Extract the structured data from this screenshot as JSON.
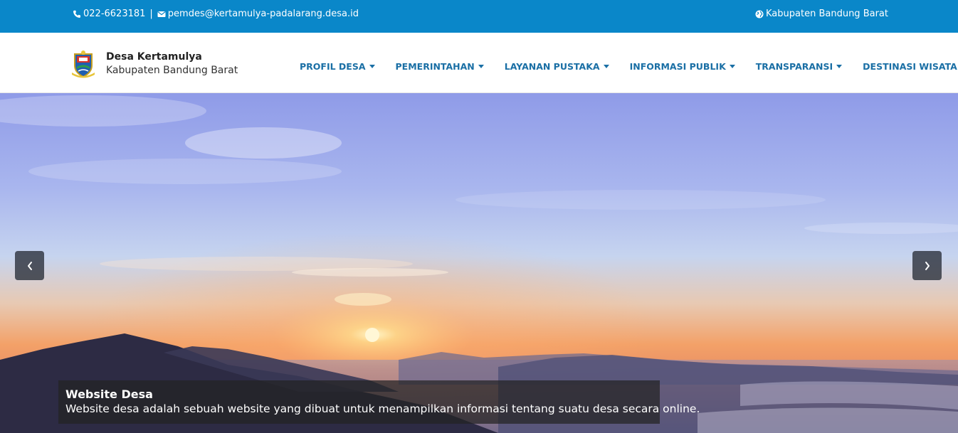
{
  "topbar": {
    "phone": "022-6623181",
    "separator": "|",
    "email": "pemdes@kertamulya-padalarang.desa.id",
    "region": "Kabupaten Bandung Barat",
    "phone_icon": "phone-icon",
    "email_icon": "envelope-icon",
    "region_icon": "globe-icon",
    "bg_color": "#0a87c9"
  },
  "brand": {
    "name": "Desa Kertamulya",
    "subtitle": "Kabupaten Bandung Barat",
    "logo_icon": "village-emblem-icon"
  },
  "nav": {
    "items": [
      {
        "label": "PROFIL DESA",
        "has_dropdown": true
      },
      {
        "label": "PEMERINTAHAN",
        "has_dropdown": true
      },
      {
        "label": "LAYANAN PUSTAKA",
        "has_dropdown": true
      },
      {
        "label": "INFORMASI PUBLIK",
        "has_dropdown": true
      },
      {
        "label": "TRANSPARANSI",
        "has_dropdown": true
      },
      {
        "label": "DESTINASI WISATA",
        "has_dropdown": false
      }
    ],
    "color": "#1a6fa5"
  },
  "slider": {
    "prev_icon": "chevron-left-icon",
    "next_icon": "chevron-right-icon",
    "caption_title": "Website Desa",
    "caption_text": "Website desa adalah sebuah website yang dibuat untuk menampilkan informasi tentang suatu desa secara online."
  }
}
